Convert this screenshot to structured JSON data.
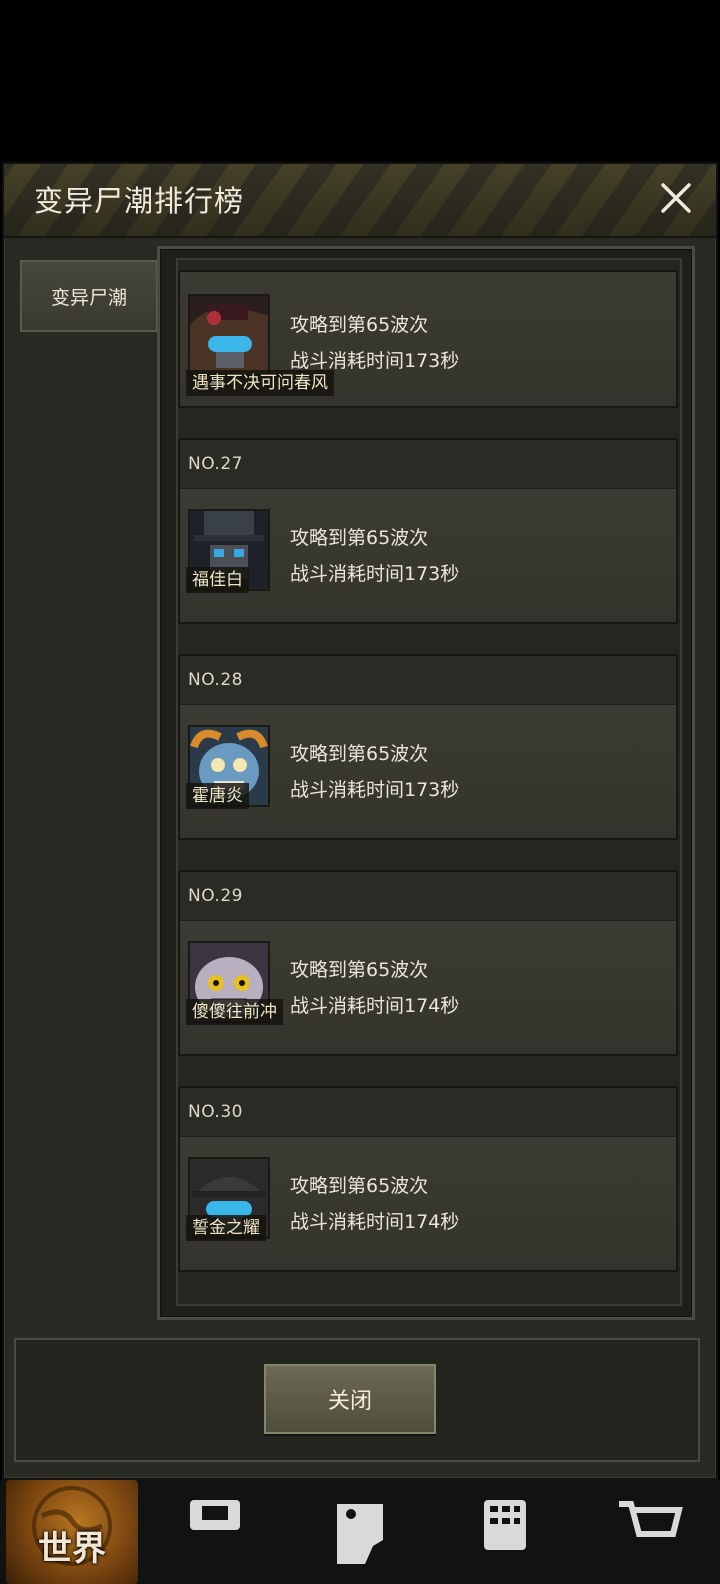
{
  "dialog": {
    "title": "变异尸潮排行榜",
    "tab_label": "变异尸潮",
    "close_label": "关闭"
  },
  "entries": [
    {
      "rank": "",
      "name": "遇事不决可问春风",
      "wave": "攻略到第65波次",
      "time": "战斗消耗时间173秒",
      "avatar": "masked-girl-red-hat-avatar"
    },
    {
      "rank": "NO.27",
      "name": "福佳白",
      "wave": "攻略到第65波次",
      "time": "战斗消耗时间173秒",
      "avatar": "top-hat-masked-avatar"
    },
    {
      "rank": "NO.28",
      "name": "霍唐炎",
      "wave": "攻略到第65波次",
      "time": "战斗消耗时间173秒",
      "avatar": "blue-beast-avatar"
    },
    {
      "rank": "NO.29",
      "name": "傻傻往前冲",
      "wave": "攻略到第65波次",
      "time": "战斗消耗时间174秒",
      "avatar": "grinning-cat-avatar"
    },
    {
      "rank": "NO.30",
      "name": "誓金之耀",
      "wave": "攻略到第65波次",
      "time": "战斗消耗时间174秒",
      "avatar": "hat-goggles-avatar"
    }
  ],
  "bottom_nav": {
    "world_label": "世界"
  }
}
